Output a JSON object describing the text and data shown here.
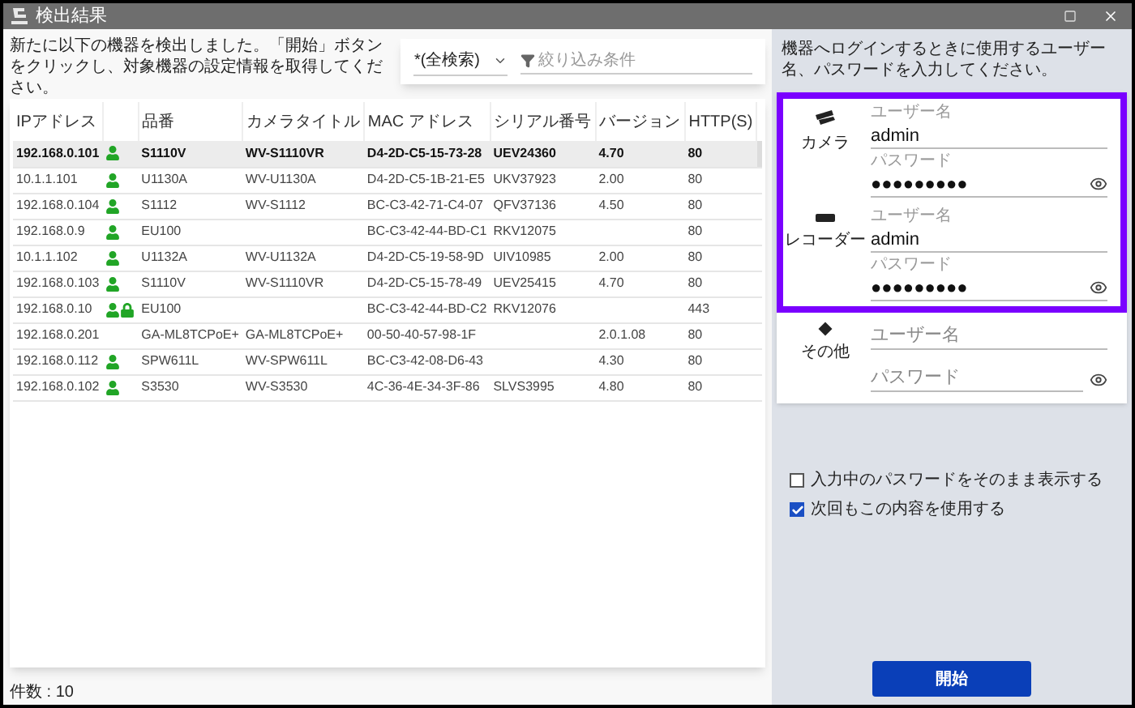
{
  "window": {
    "title": "検出結果"
  },
  "description": "新たに以下の機器を検出しました。「開始」ボタンをクリックし、対象機器の設定情報を取得してください。",
  "filter": {
    "search_scope": "*(全検索)",
    "placeholder": "絞り込み条件"
  },
  "table": {
    "columns": [
      "IPアドレス",
      "",
      "品番",
      "カメラタイトル",
      "MAC アドレス",
      "シリアル番号",
      "バージョン",
      "HTTP(S)"
    ],
    "rows": [
      {
        "selected": true,
        "user": true,
        "locked": false,
        "cells": [
          "192.168.0.101",
          "",
          "S1110V",
          "WV-S1110VR",
          "D4-2D-C5-15-73-28",
          "UEV24360",
          "4.70",
          "80"
        ]
      },
      {
        "selected": false,
        "user": true,
        "locked": false,
        "cells": [
          "10.1.1.101",
          "",
          "U1130A",
          "WV-U1130A",
          "D4-2D-C5-1B-21-E5",
          "UKV37923",
          "2.00",
          "80"
        ]
      },
      {
        "selected": false,
        "user": true,
        "locked": false,
        "cells": [
          "192.168.0.104",
          "",
          "S1112",
          "WV-S1112",
          "BC-C3-42-71-C4-07",
          "QFV37136",
          "4.50",
          "80"
        ]
      },
      {
        "selected": false,
        "user": true,
        "locked": false,
        "cells": [
          "192.168.0.9",
          "",
          "EU100",
          "",
          "BC-C3-42-44-BD-C1",
          "RKV12075",
          "",
          "80"
        ]
      },
      {
        "selected": false,
        "user": true,
        "locked": false,
        "cells": [
          "10.1.1.102",
          "",
          "U1132A",
          "WV-U1132A",
          "D4-2D-C5-19-58-9D",
          "UIV10985",
          "2.00",
          "80"
        ]
      },
      {
        "selected": false,
        "user": true,
        "locked": false,
        "cells": [
          "192.168.0.103",
          "",
          "S1110V",
          "WV-S1110VR",
          "D4-2D-C5-15-78-49",
          "UEV25415",
          "4.70",
          "80"
        ]
      },
      {
        "selected": false,
        "user": true,
        "locked": true,
        "cells": [
          "192.168.0.10",
          "",
          "EU100",
          "",
          "BC-C3-42-44-BD-C2",
          "RKV12076",
          "",
          "443"
        ]
      },
      {
        "selected": false,
        "user": false,
        "locked": false,
        "cells": [
          "192.168.0.201",
          "",
          "GA-ML8TCPoE+",
          "GA-ML8TCPoE+",
          "00-50-40-57-98-1F",
          "",
          "2.0.1.08",
          "80"
        ]
      },
      {
        "selected": false,
        "user": true,
        "locked": false,
        "cells": [
          "192.168.0.112",
          "",
          "SPW611L",
          "WV-SPW611L",
          "BC-C3-42-08-D6-43",
          "",
          "4.30",
          "80"
        ]
      },
      {
        "selected": false,
        "user": true,
        "locked": false,
        "cells": [
          "192.168.0.102",
          "",
          "S3530",
          "WV-S3530",
          "4C-36-4E-34-3F-86",
          "SLVS3995",
          "4.80",
          "80"
        ]
      }
    ]
  },
  "count": "件数 : 10",
  "login_description": "機器へログインするときに使用するユーザー名、パスワードを入力してください。",
  "credentials": [
    {
      "kind": "camera",
      "device": "カメラ",
      "highlighted": true,
      "username_label": "ユーザー名",
      "username": "admin",
      "password_label": "パスワード",
      "password": "●●●●●●●●●"
    },
    {
      "kind": "recorder",
      "device": "レコーダー",
      "highlighted": true,
      "username_label": "ユーザー名",
      "username": "admin",
      "password_label": "パスワード",
      "password": "●●●●●●●●●"
    },
    {
      "kind": "other",
      "device": "その他",
      "highlighted": false,
      "username_placeholder": "ユーザー名",
      "password_placeholder": "パスワード"
    }
  ],
  "options": [
    {
      "label": "入力中のパスワードをそのまま表示する",
      "checked": false
    },
    {
      "label": "次回もこの内容を使用する",
      "checked": true
    }
  ],
  "start_button": "開始"
}
